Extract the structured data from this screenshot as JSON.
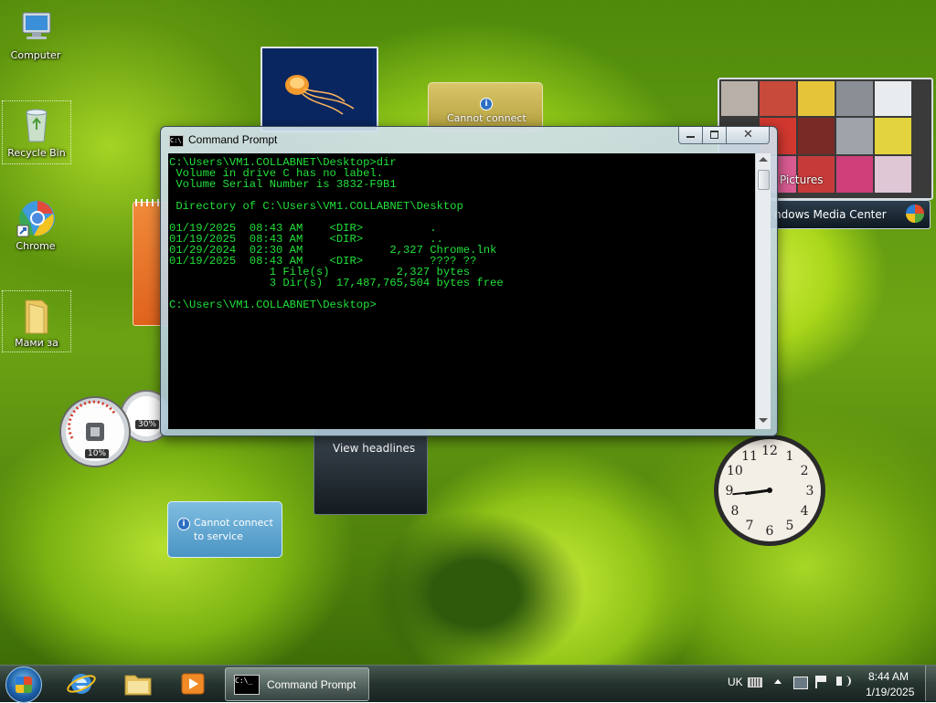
{
  "desktop": {
    "icons": [
      {
        "label": "Computer"
      },
      {
        "label": "Recycle Bin"
      },
      {
        "label": "Chrome"
      },
      {
        "label": "Мами за"
      }
    ]
  },
  "gadgets": {
    "weather_message": "Cannot connect",
    "slideshow_label": "Pictures",
    "media_center_label": "ndows Media Center",
    "headlines_label": "View headlines",
    "service_message_line1": "Cannot connect",
    "service_message_line2": "to service",
    "cpu_percent": "10%",
    "memory_percent": "30%",
    "clock": {
      "numbers": [
        "12",
        "1",
        "2",
        "3",
        "4",
        "5",
        "6",
        "7",
        "8",
        "9",
        "10",
        "11"
      ],
      "hour": 8,
      "minute": 44
    }
  },
  "cmd": {
    "title": "Command Prompt",
    "console": "C:\\Users\\VM1.COLLABNET\\Desktop>dir\n Volume in drive C has no label.\n Volume Serial Number is 3832-F9B1\n\n Directory of C:\\Users\\VM1.COLLABNET\\Desktop\n\n01/19/2025  08:43 AM    <DIR>          .\n01/19/2025  08:43 AM    <DIR>          ..\n01/29/2024  02:30 AM             2,327 Chrome.lnk\n01/19/2025  08:43 AM    <DIR>          ???? ??\n               1 File(s)          2,327 bytes\n               3 Dir(s)  17,487,765,504 bytes free\n\nC:\\Users\\VM1.COLLABNET\\Desktop>"
  },
  "taskbar": {
    "active_window": "Command Prompt",
    "language": "UK",
    "time": "8:44 AM",
    "date": "1/19/2025"
  },
  "colors": {
    "console_text": "#22e03a",
    "console_bg": "#000000"
  }
}
